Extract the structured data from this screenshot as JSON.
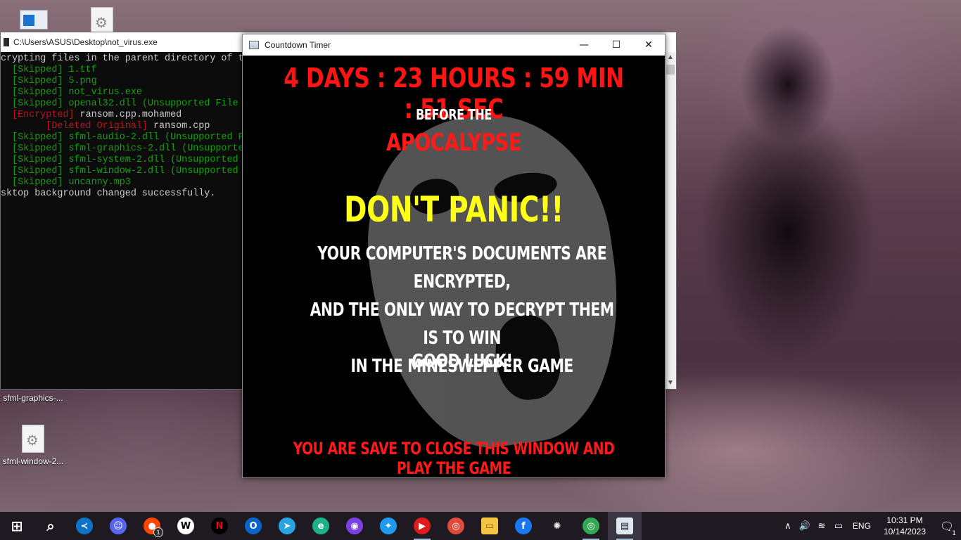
{
  "desktop": {
    "icons": [
      {
        "label": "sfml-graphics-..."
      },
      {
        "label": "sfml-window-2..."
      }
    ]
  },
  "console": {
    "title": "C:\\Users\\ASUS\\Desktop\\not_virus.exe",
    "lines": [
      {
        "pre": "",
        "tag": "",
        "name": "crypting files in the parent directory of t",
        "note": ""
      },
      {
        "pre": "  ",
        "tag": "[Skipped]",
        "name": "1.ttf",
        "note": ""
      },
      {
        "pre": "  ",
        "tag": "[Skipped]",
        "name": "5.png",
        "note": ""
      },
      {
        "pre": "  ",
        "tag": "[Skipped]",
        "name": "not_virus.exe",
        "note": ""
      },
      {
        "pre": "  ",
        "tag": "[Skipped]",
        "name": "openal32.dll",
        "note": "(Unsupported File"
      },
      {
        "pre": "  ",
        "tag": "[Encrypted]",
        "name": "ransom.cpp.mohamed",
        "note": ""
      },
      {
        "pre": "        ",
        "tag": "[Deleted Original]",
        "name": "ransom.cpp",
        "note": ""
      },
      {
        "pre": "  ",
        "tag": "[Skipped]",
        "name": "sfml-audio-2.dll",
        "note": "(Unsupported F"
      },
      {
        "pre": "  ",
        "tag": "[Skipped]",
        "name": "sfml-graphics-2.dll",
        "note": "(Unsupporte"
      },
      {
        "pre": "  ",
        "tag": "[Skipped]",
        "name": "sfml-system-2.dll",
        "note": "(Unsupported"
      },
      {
        "pre": "  ",
        "tag": "[Skipped]",
        "name": "sfml-window-2.dll",
        "note": "(Unsupported"
      },
      {
        "pre": "  ",
        "tag": "[Skipped]",
        "name": "uncanny.mp3",
        "note": ""
      },
      {
        "pre": "",
        "tag": "",
        "name": "sktop background changed successfully.",
        "note": ""
      }
    ]
  },
  "countdown": {
    "title": "Countdown Timer",
    "timer": "4 DAYS : 23 HOURS : 59 MIN : 51 SEC",
    "before": "BEFORE THE",
    "apocalypse": "APOCALYPSE",
    "panic": "DON'T PANIC!!",
    "message_lines": [
      "YOUR COMPUTER'S DOCUMENTS ARE ENCRYPTED,",
      "AND THE ONLY WAY TO DECRYPT THEM IS TO WIN",
      "IN THE MINESWEPPER GAME"
    ],
    "good_luck": "GOOD LUCK!",
    "save_note": "YOU ARE SAVE TO CLOSE THIS WINDOW AND PLAY THE GAME",
    "controls": {
      "minimize": "—",
      "maximize": "☐",
      "close": "✕"
    }
  },
  "taskbar": {
    "apps": [
      {
        "icon": "start-icon",
        "glyph": "⊞",
        "color": "#ffffff",
        "bg": "transparent",
        "state": "normal",
        "badge": ""
      },
      {
        "icon": "search-icon",
        "glyph": "⌕",
        "color": "#ffffff",
        "bg": "transparent",
        "state": "normal",
        "badge": ""
      },
      {
        "icon": "vscode-icon",
        "glyph": "≺",
        "color": "#ffffff",
        "bg": "#0e72c7",
        "state": "normal",
        "badge": ""
      },
      {
        "icon": "discord-icon",
        "glyph": "☺",
        "color": "#ffffff",
        "bg": "#5865f2",
        "state": "normal",
        "badge": ""
      },
      {
        "icon": "reddit-icon",
        "glyph": "●",
        "color": "#ffffff",
        "bg": "#ff4500",
        "state": "normal",
        "badge": "1"
      },
      {
        "icon": "wiki-icon",
        "glyph": "W",
        "color": "#000000",
        "bg": "#ffffff",
        "state": "normal",
        "badge": ""
      },
      {
        "icon": "netflix-icon",
        "glyph": "N",
        "color": "#e50914",
        "bg": "#000000",
        "state": "normal",
        "badge": ""
      },
      {
        "icon": "outlook-icon",
        "glyph": "O",
        "color": "#ffffff",
        "bg": "#0a64c8",
        "state": "normal",
        "badge": ""
      },
      {
        "icon": "telegram-icon",
        "glyph": "➤",
        "color": "#ffffff",
        "bg": "#2aa3e0",
        "state": "normal",
        "badge": ""
      },
      {
        "icon": "edge-icon",
        "glyph": "e",
        "color": "#ffffff",
        "bg": "#1db28a",
        "state": "normal",
        "badge": ""
      },
      {
        "icon": "podcast-icon",
        "glyph": "◉",
        "color": "#ffffff",
        "bg": "#7b3fe4",
        "state": "normal",
        "badge": ""
      },
      {
        "icon": "twitter-icon",
        "glyph": "✦",
        "color": "#ffffff",
        "bg": "#1d9bf0",
        "state": "normal",
        "badge": ""
      },
      {
        "icon": "youtube-icon",
        "glyph": "▶",
        "color": "#ffffff",
        "bg": "#e01b1b",
        "state": "running",
        "badge": ""
      },
      {
        "icon": "chrome-icon",
        "glyph": "◎",
        "color": "#ffffff",
        "bg": "#e04a3c",
        "state": "normal",
        "badge": ""
      },
      {
        "icon": "file-explorer-icon",
        "glyph": "▭",
        "color": "#7a5a00",
        "bg": "#f4c542",
        "state": "normal",
        "badge": ""
      },
      {
        "icon": "facebook-icon",
        "glyph": "f",
        "color": "#ffffff",
        "bg": "#1877f2",
        "state": "normal",
        "badge": ""
      },
      {
        "icon": "chatgpt-icon",
        "glyph": "✺",
        "color": "#ffffff",
        "bg": "transparent",
        "state": "normal",
        "badge": ""
      },
      {
        "icon": "chrome-profile-icon",
        "glyph": "◎",
        "color": "#ffffff",
        "bg": "#34a853",
        "state": "running",
        "badge": ""
      },
      {
        "icon": "countdown-timer-icon",
        "glyph": "▤",
        "color": "#1f1a22",
        "bg": "#dfe7ef",
        "state": "active",
        "badge": ""
      }
    ],
    "tray": {
      "chevron": "∧",
      "volume": "🔊",
      "network": "≋",
      "battery": "▭",
      "language": "ENG",
      "time": "10:31 PM",
      "date": "10/14/2023",
      "notifications": "🗨",
      "notification_count": "1"
    }
  }
}
